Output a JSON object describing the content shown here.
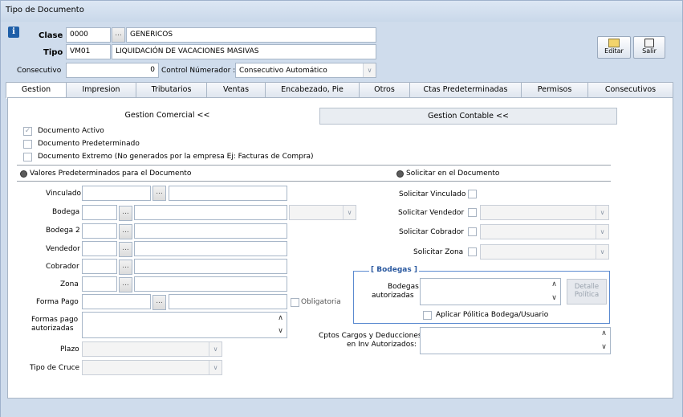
{
  "window": {
    "title": "Tipo de Documento"
  },
  "header": {
    "clase_label": "Clase",
    "clase_code": "0000",
    "clase_name": "GENERICOS",
    "tipo_label": "Tipo",
    "tipo_code": "VM01",
    "tipo_name": "LIQUIDACIÓN DE VACACIONES MASIVAS",
    "consecutivo_label": "Consecutivo",
    "consecutivo_value": "0",
    "control_label": "Control Númerador :",
    "control_value": "Consecutivo Automático",
    "dots": "..."
  },
  "toolbar": {
    "editar_label": "Editar",
    "salir_label": "Salir"
  },
  "tabs": [
    "Gestion",
    "Impresion",
    "Tributarios",
    "Ventas",
    "Encabezado, Pie",
    "Otros",
    "Ctas Predeterminadas",
    "Permisos",
    "Consecutivos"
  ],
  "subtabs": {
    "comercial": "Gestion Comercial <<",
    "contable": "Gestion Contable <<"
  },
  "checks": {
    "activo": "Documento Activo",
    "predeterminado": "Documento Predeterminado",
    "externo": "Documento Extremo (No generados por la empresa  Ej: Facturas de Compra)"
  },
  "sections": {
    "valores": "Valores Predeterminados para el Documento",
    "solicitar": "Solicitar en el Documento"
  },
  "left_fields": {
    "vinculado": "Vinculado",
    "bodega": "Bodega",
    "bodega2": "Bodega 2",
    "vendedor": "Vendedor",
    "cobrador": "Cobrador",
    "zona": "Zona",
    "forma_pago": "Forma Pago",
    "obligatoria": "Obligatoria",
    "formas_pago_1": "Formas pago",
    "formas_pago_2": "autorizadas",
    "plazo": "Plazo",
    "tipo_cruce": "Tipo de Cruce"
  },
  "right_fields": {
    "sol_vinculado": "Solicitar Vinculado",
    "sol_vendedor": "Solicitar Vendedor",
    "sol_cobrador": "Solicitar Cobrador",
    "sol_zona": "Solicitar Zona",
    "bodegas_group": "[ Bodegas ]",
    "bodegas_aut_1": "Bodegas",
    "bodegas_aut_2": "autorizadas",
    "detalle_1": "Detalle",
    "detalle_2": "Política",
    "aplicar": "Aplicar Pólitica Bodega/Usuario",
    "cptos_1": "Cptos Cargos y Deducciones",
    "cptos_2": "en Inv Autorizados:"
  },
  "icons": {
    "info": "info-icon",
    "editar": "edit-icon",
    "salir": "exit-icon"
  },
  "colors": {
    "window_bg": "#cfdcec",
    "accent": "#1f5fa8",
    "group_title": "#2c5aa0"
  }
}
